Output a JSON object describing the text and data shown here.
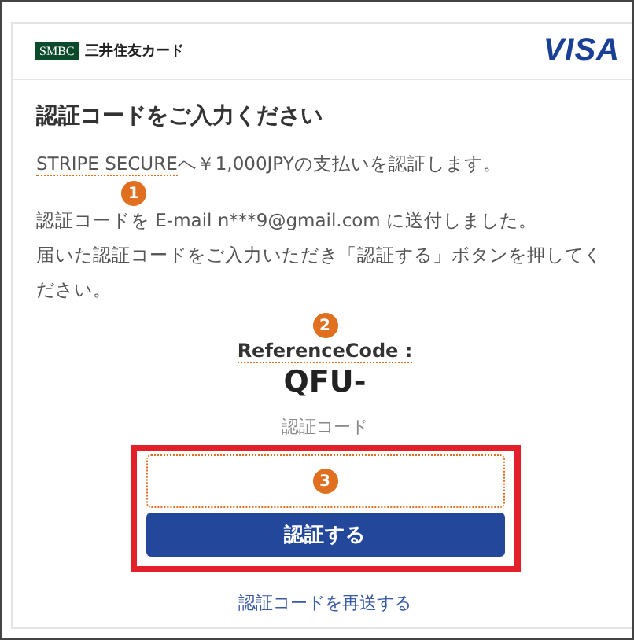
{
  "header": {
    "logo_mark": "SMBC",
    "brand": "三井住友カード",
    "network": "VISA"
  },
  "title": "認証コードをご入力ください",
  "payment": {
    "merchant": "STRIPE SECURE",
    "text": "へ￥1,000JPYの支払いを認証します。"
  },
  "messages": [
    "認証コードを E-mail n***9@gmail.com に送付しました。",
    "届いた認証コードをご入力いただき「認証する」ボタンを押してください。"
  ],
  "reference": {
    "label": "ReferenceCode :",
    "value": "QFU-"
  },
  "code_field": {
    "label": "認証コード"
  },
  "submit_button": "認証する",
  "resend_link": "認証コードを再送する",
  "annotations": [
    "1",
    "2",
    "3"
  ]
}
